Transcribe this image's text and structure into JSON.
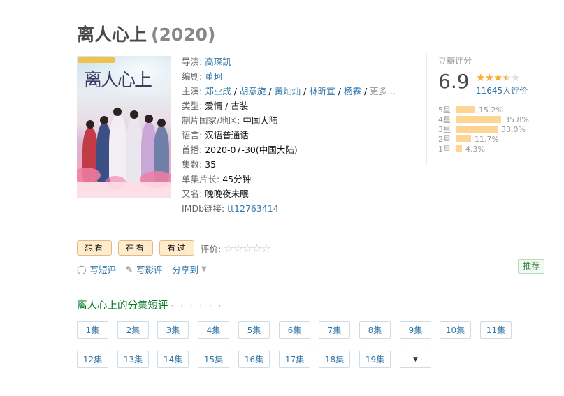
{
  "title": "离人心上",
  "year": "(2020)",
  "info": {
    "director_label": "导演:",
    "director": "高琛凯",
    "writer_label": "编剧:",
    "writer": "董珂",
    "cast_label": "主演:",
    "cast": [
      "郑业成",
      "胡意旋",
      "黄灿灿",
      "林昕宜",
      "杨霖"
    ],
    "cast_more": "更多...",
    "genre_label": "类型:",
    "genre": "爱情 / 古装",
    "region_label": "制片国家/地区:",
    "region": "中国大陆",
    "language_label": "语言:",
    "language": "汉语普通话",
    "premiere_label": "首播:",
    "premiere": "2020-07-30(中国大陆)",
    "episodes_label": "集数:",
    "episodes": "35",
    "runtime_label": "单集片长:",
    "runtime": "45分钟",
    "aka_label": "又名:",
    "aka": "晚晚夜未眠",
    "imdb_label": "IMDb链接:",
    "imdb": "tt12763414"
  },
  "rating": {
    "label": "豆瓣评分",
    "score": "6.9",
    "stars_value": 3.5,
    "count": "11645人评价",
    "bars": [
      {
        "label": "5星",
        "percent": "15.2%",
        "value": 15.2
      },
      {
        "label": "4星",
        "percent": "35.8%",
        "value": 35.8
      },
      {
        "label": "3星",
        "percent": "33.0%",
        "value": 33.0
      },
      {
        "label": "2星",
        "percent": "11.7%",
        "value": 11.7
      },
      {
        "label": "1星",
        "percent": "4.3%",
        "value": 4.3
      }
    ],
    "bar_color": "#ffd596",
    "star_color": "#ffac2d"
  },
  "actions": {
    "want": "想看",
    "watching": "在看",
    "watched": "看过",
    "rate_label": "评价:"
  },
  "links": {
    "short_review": "写短评",
    "review": "写影评",
    "share": "分享到"
  },
  "recommend": "推荐",
  "episode_section": {
    "title": "离人心上的分集短评",
    "dots": "· · · · · ·",
    "episodes": [
      "1集",
      "2集",
      "3集",
      "4集",
      "5集",
      "6集",
      "7集",
      "8集",
      "9集",
      "10集",
      "11集",
      "12集",
      "13集",
      "14集",
      "15集",
      "16集",
      "17集",
      "18集",
      "19集"
    ],
    "more_icon": "caret-down-icon"
  },
  "colors": {
    "link": "#3377aa",
    "green_title": "#007722",
    "button_bg": "#ffeccd"
  }
}
